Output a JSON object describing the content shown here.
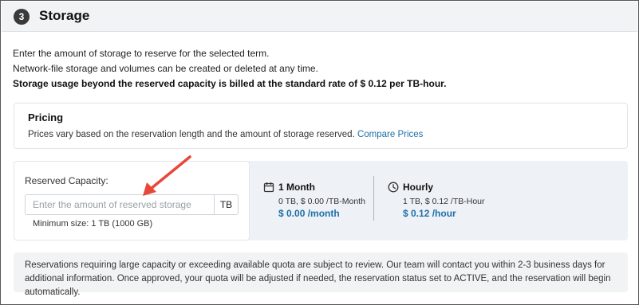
{
  "section": {
    "step_number": "3",
    "title": "Storage"
  },
  "intro": {
    "line1": "Enter the amount of storage to reserve for the selected term.",
    "line2": "Network-file storage and volumes can be created or deleted at any time.",
    "line3": "Storage usage beyond the reserved capacity is billed at the standard rate of $ 0.12 per TB-hour."
  },
  "pricing": {
    "title": "Pricing",
    "text": "Prices vary based on the reservation length and the amount of storage reserved.",
    "link_label": "Compare Prices"
  },
  "capacity": {
    "label": "Reserved Capacity:",
    "input_value": "",
    "placeholder": "Enter the amount of reserved storage",
    "unit": "TB",
    "minimum": "Minimum size: 1 TB (1000 GB)"
  },
  "options": [
    {
      "icon": "calendar-icon",
      "title": "1 Month",
      "detail": "0 TB, $ 0.00 /TB-Month",
      "price": "$ 0.00 /month"
    },
    {
      "icon": "clock-icon",
      "title": "Hourly",
      "detail": "1 TB, $ 0.12 /TB-Hour",
      "price": "$ 0.12 /hour"
    }
  ],
  "notice": "Reservations requiring large capacity or exceeding available quota are subject to review. Our team will contact you within 2-3 business days for additional information. Once approved, your quota will be adjusted if needed, the reservation status set to ACTIVE, and the reservation will begin automatically.",
  "colors": {
    "accent": "#1f6fa8",
    "annotation_arrow": "#e8483a",
    "panel_background": "#eef2f6"
  }
}
